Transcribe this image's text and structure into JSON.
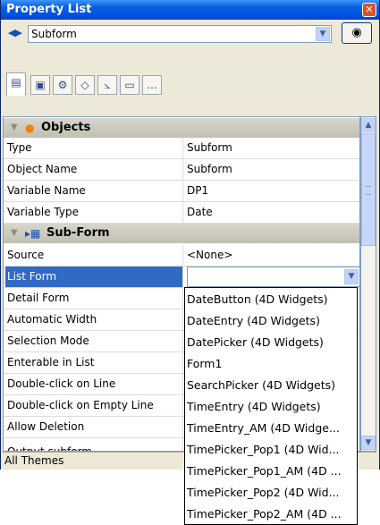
{
  "window": {
    "title": "Property List",
    "close_glyph": "✕"
  },
  "selector": {
    "value": "Subform",
    "nav_arrows": "◀▶"
  },
  "tabs": [
    {
      "icon": "properties-icon",
      "glyph": "▤"
    },
    {
      "icon": "display-icon",
      "glyph": "▣"
    },
    {
      "icon": "gear-icon",
      "glyph": "⚙"
    },
    {
      "icon": "objects-icon",
      "glyph": "◇"
    },
    {
      "icon": "chart-icon",
      "glyph": "⦣"
    },
    {
      "icon": "monitor-icon",
      "glyph": "▭"
    },
    {
      "icon": "more-icon",
      "glyph": "…"
    }
  ],
  "sections": {
    "objects": {
      "title": "Objects",
      "icon_glyph": "●"
    },
    "subform": {
      "title": "Sub-Form",
      "icon_glyph": "▸▦"
    }
  },
  "rows": {
    "type": {
      "label": "Type",
      "value": "Subform"
    },
    "object_name": {
      "label": "Object Name",
      "value": "Subform"
    },
    "variable_name": {
      "label": "Variable Name",
      "value": "DP1"
    },
    "variable_type": {
      "label": "Variable Type",
      "value": "Date"
    },
    "source": {
      "label": "Source",
      "value": "<None>"
    },
    "list_form": {
      "label": "List Form",
      "value": ""
    },
    "detail_form": {
      "label": "Detail Form"
    },
    "automatic_width": {
      "label": "Automatic Width"
    },
    "selection_mode": {
      "label": "Selection Mode"
    },
    "enterable_in_list": {
      "label": "Enterable in List"
    },
    "double_click_line": {
      "label": "Double-click on Line"
    },
    "double_click_empty": {
      "label": "Double-click on Empty Line"
    },
    "allow_deletion": {
      "label": "Allow Deletion"
    },
    "output_subform": {
      "label": "Output subform"
    }
  },
  "dropdown_options": [
    "DateButton (4D Widgets)",
    "DateEntry (4D Widgets)",
    "DatePicker (4D Widgets)",
    "Form1",
    "SearchPicker (4D Widgets)",
    "TimeEntry (4D Widgets)",
    "TimeEntry_AM (4D Widge...",
    "TimePicker_Pop1 (4D Wid...",
    "TimePicker_Pop1_AM (4D ...",
    "TimePicker_Pop2 (4D Wid...",
    "TimePicker_Pop2_AM (4D ..."
  ],
  "status": {
    "text": "All Themes"
  },
  "colors": {
    "titlebar": "#0054e3",
    "selection": "#316ac5",
    "accent": "#f08000"
  }
}
